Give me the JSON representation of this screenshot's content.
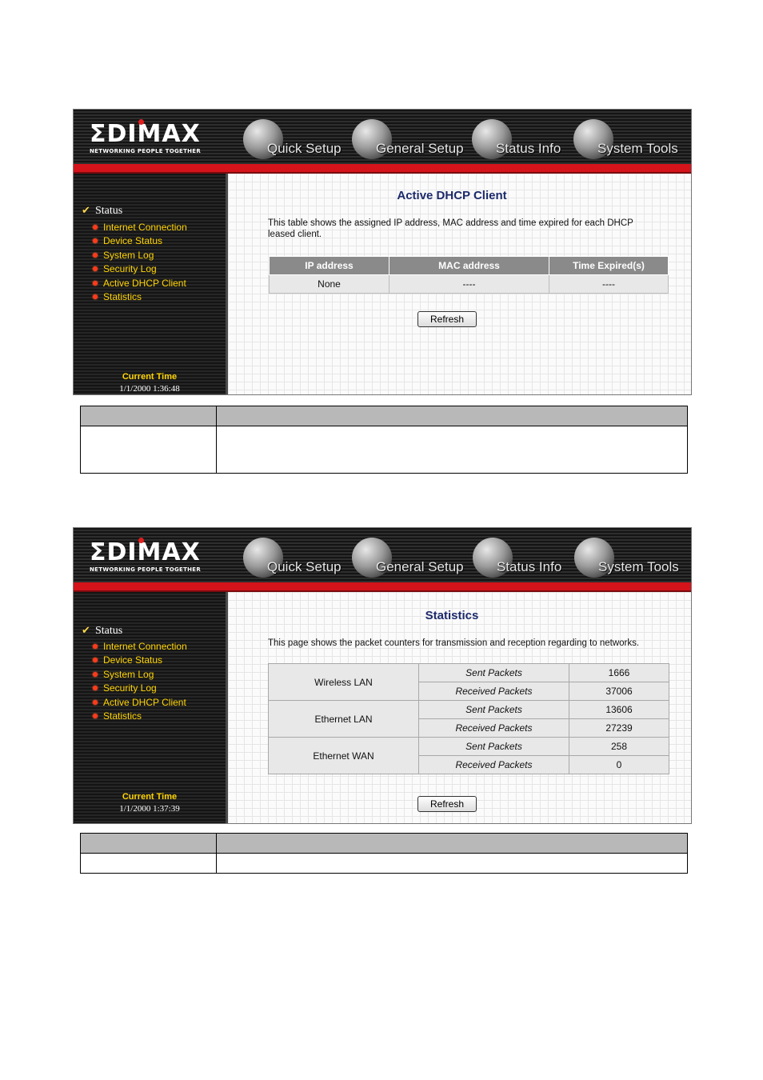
{
  "brand": {
    "logo": "ΣDIMAX",
    "tagline": "NETWORKING PEOPLE TOGETHER"
  },
  "nav": [
    {
      "label": "Quick Setup",
      "icon": "quick-setup-globe-icon"
    },
    {
      "label": "General Setup",
      "icon": "general-setup-globe-icon"
    },
    {
      "label": "Status Info",
      "icon": "status-info-globe-icon"
    },
    {
      "label": "System Tools",
      "icon": "system-tools-globe-icon"
    }
  ],
  "sidebar": {
    "section": "Status",
    "items": [
      "Internet Connection",
      "Device Status",
      "System Log",
      "Security Log",
      "Active DHCP Client",
      "Statistics"
    ],
    "current_time_label": "Current Time"
  },
  "dhcp_page": {
    "title": "Active DHCP Client",
    "description": "This table shows the assigned IP address, MAC address and time expired for each DHCP leased client.",
    "headers": [
      "IP address",
      "MAC address",
      "Time Expired(s)"
    ],
    "row": [
      "None",
      "----",
      "----"
    ],
    "refresh_label": "Refresh",
    "current_time": "1/1/2000 1:36:48"
  },
  "stats_page": {
    "title": "Statistics",
    "description": "This page shows the packet counters for transmission and reception regarding to networks.",
    "rows": [
      {
        "name": "Wireless LAN",
        "sent_label": "Sent Packets",
        "sent": "1666",
        "recv_label": "Received Packets",
        "recv": "37006"
      },
      {
        "name": "Ethernet LAN",
        "sent_label": "Sent Packets",
        "sent": "13606",
        "recv_label": "Received Packets",
        "recv": "27239"
      },
      {
        "name": "Ethernet WAN",
        "sent_label": "Sent Packets",
        "sent": "258",
        "recv_label": "Received Packets",
        "recv": "0"
      }
    ],
    "refresh_label": "Refresh",
    "current_time": "1/1/2000 1:37:39"
  },
  "colors": {
    "header_red": "#d4131b",
    "sidebar_link": "#ffd400",
    "title_blue": "#1c2a6a",
    "table_header": "#8a8a8a"
  }
}
